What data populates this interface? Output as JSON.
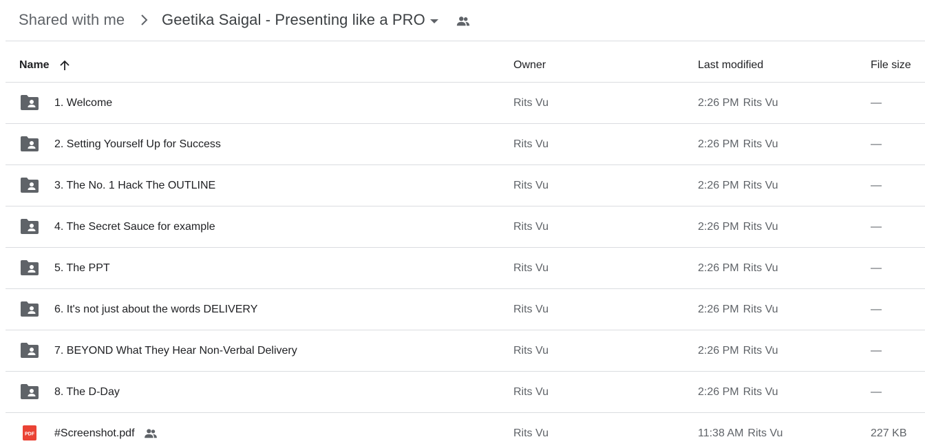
{
  "breadcrumb": {
    "root": "Shared with me",
    "current": "Geetika Saigal - Presenting like a PRO"
  },
  "columns": {
    "name": "Name",
    "owner": "Owner",
    "last_modified": "Last modified",
    "file_size": "File size"
  },
  "files": [
    {
      "name": "1. Welcome",
      "type": "shared-folder",
      "owner": "Rits Vu",
      "modified_time": "2:26 PM",
      "modified_by": "Rits Vu",
      "size": "—"
    },
    {
      "name": "2. Setting Yourself Up for Success",
      "type": "shared-folder",
      "owner": "Rits Vu",
      "modified_time": "2:26 PM",
      "modified_by": "Rits Vu",
      "size": "—"
    },
    {
      "name": "3. The No. 1 Hack The OUTLINE",
      "type": "shared-folder",
      "owner": "Rits Vu",
      "modified_time": "2:26 PM",
      "modified_by": "Rits Vu",
      "size": "—"
    },
    {
      "name": "4. The Secret Sauce for example",
      "type": "shared-folder",
      "owner": "Rits Vu",
      "modified_time": "2:26 PM",
      "modified_by": "Rits Vu",
      "size": "—"
    },
    {
      "name": "5. The PPT",
      "type": "shared-folder",
      "owner": "Rits Vu",
      "modified_time": "2:26 PM",
      "modified_by": "Rits Vu",
      "size": "—"
    },
    {
      "name": "6. It's not just about the words DELIVERY",
      "type": "shared-folder",
      "owner": "Rits Vu",
      "modified_time": "2:26 PM",
      "modified_by": "Rits Vu",
      "size": "—"
    },
    {
      "name": "7. BEYOND What They Hear Non-Verbal Delivery",
      "type": "shared-folder",
      "owner": "Rits Vu",
      "modified_time": "2:26 PM",
      "modified_by": "Rits Vu",
      "size": "—"
    },
    {
      "name": "8. The D-Day",
      "type": "shared-folder",
      "owner": "Rits Vu",
      "modified_time": "2:26 PM",
      "modified_by": "Rits Vu",
      "size": "—"
    },
    {
      "name": "#Screenshot.pdf",
      "type": "pdf",
      "shared": true,
      "owner": "Rits Vu",
      "modified_time": "11:38 AM",
      "modified_by": "Rits Vu",
      "size": "227 KB"
    }
  ],
  "icons": {
    "breadcrumb_separator": "chevron-right-icon",
    "breadcrumb_dropdown": "caret-down-icon",
    "breadcrumb_shared": "people-icon",
    "sort": "arrow-up-icon",
    "folder": "shared-folder-icon",
    "pdf": "pdf-icon",
    "pdf_label": "PDF"
  },
  "colors": {
    "icon_gray": "#5f6368",
    "pdf_red": "#ea4335",
    "divider": "#dadce0"
  }
}
